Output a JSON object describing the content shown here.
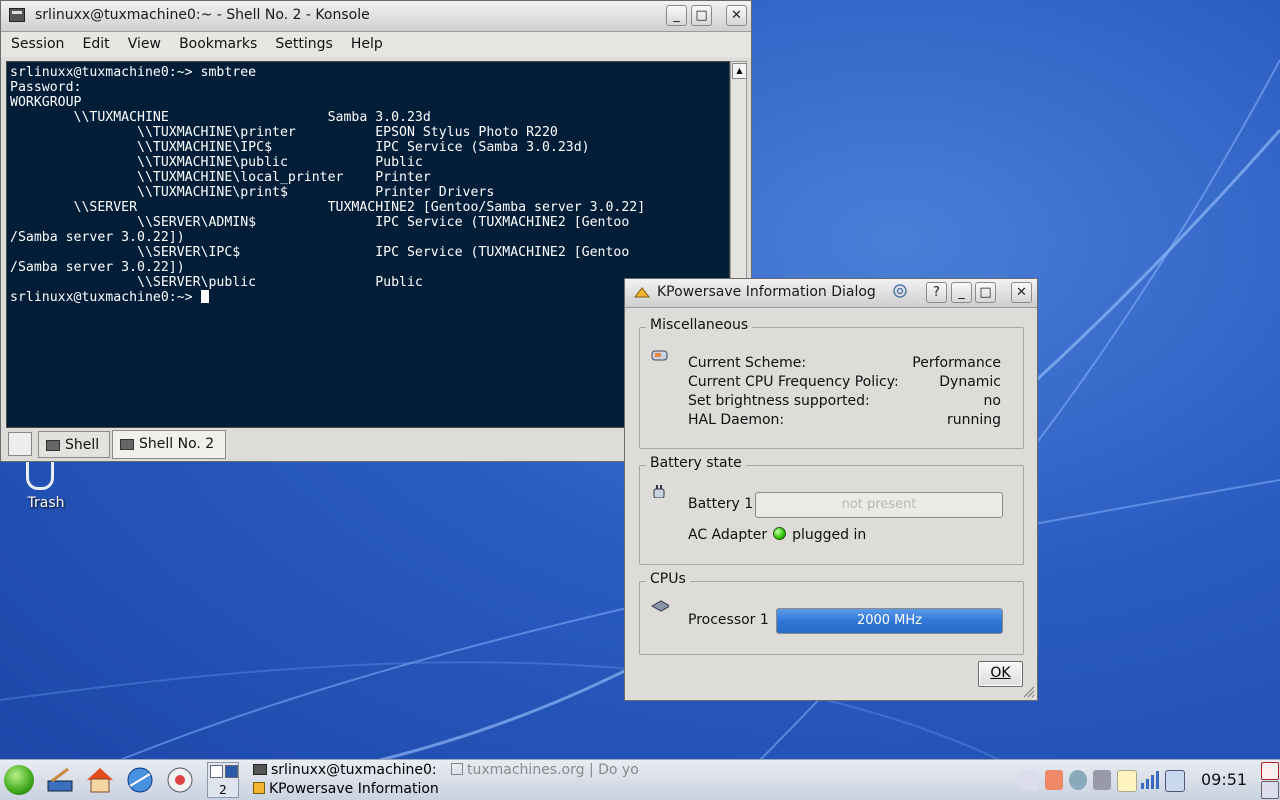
{
  "konsole": {
    "title": "srlinuxx@tuxmachine0:~ - Shell No. 2 - Konsole",
    "buttons": {
      "minimize": "_",
      "maximize": "□",
      "close": "✕"
    },
    "menu": [
      "Session",
      "Edit",
      "View",
      "Bookmarks",
      "Settings",
      "Help"
    ],
    "terminal_lines": [
      "srlinuxx@tuxmachine0:~> smbtree",
      "Password:",
      "WORKGROUP",
      "        \\\\TUXMACHINE                    Samba 3.0.23d",
      "                \\\\TUXMACHINE\\printer          EPSON Stylus Photo R220",
      "                \\\\TUXMACHINE\\IPC$             IPC Service (Samba 3.0.23d)",
      "                \\\\TUXMACHINE\\public           Public",
      "                \\\\TUXMACHINE\\local_printer    Printer",
      "                \\\\TUXMACHINE\\print$           Printer Drivers",
      "        \\\\SERVER                        TUXMACHINE2 [Gentoo/Samba server 3.0.22]",
      "                \\\\SERVER\\ADMIN$               IPC Service (TUXMACHINE2 [Gentoo",
      "/Samba server 3.0.22])",
      "                \\\\SERVER\\IPC$                 IPC Service (TUXMACHINE2 [Gentoo",
      "/Samba server 3.0.22])",
      "                \\\\SERVER\\public               Public"
    ],
    "prompt": "srlinuxx@tuxmachine0:~> ",
    "tabs": [
      "Shell",
      "Shell No. 2"
    ]
  },
  "desktop": {
    "trash_label": "Trash"
  },
  "dialog": {
    "title": "KPowersave Information Dialog",
    "buttons": {
      "help": "?",
      "minimize": "_",
      "maximize": "□",
      "close": "✕"
    },
    "misc": {
      "title": "Miscellaneous",
      "rows": [
        {
          "label": "Current Scheme:",
          "value": "Performance"
        },
        {
          "label": "Current CPU Frequency Policy:",
          "value": "Dynamic"
        },
        {
          "label": "Set brightness supported:",
          "value": "no"
        },
        {
          "label": "HAL Daemon:",
          "value": "running"
        }
      ]
    },
    "battery": {
      "title": "Battery state",
      "label": "Battery 1",
      "status": "not present",
      "ac_label": "AC Adapter",
      "ac_status": "plugged in",
      "ac_color": "#2cc400"
    },
    "cpus": {
      "title": "CPUs",
      "label": "Processor 1",
      "frequency": "2000 MHz",
      "bar_color": "#2f78d8"
    },
    "ok_label": "OK"
  },
  "taskbar": {
    "pager_label": "2",
    "tasks": [
      "srlinuxx@tuxmachine0:~",
      "tuxmachines.org | Do yo",
      "KPowersave Information"
    ],
    "clock": "09:51"
  }
}
